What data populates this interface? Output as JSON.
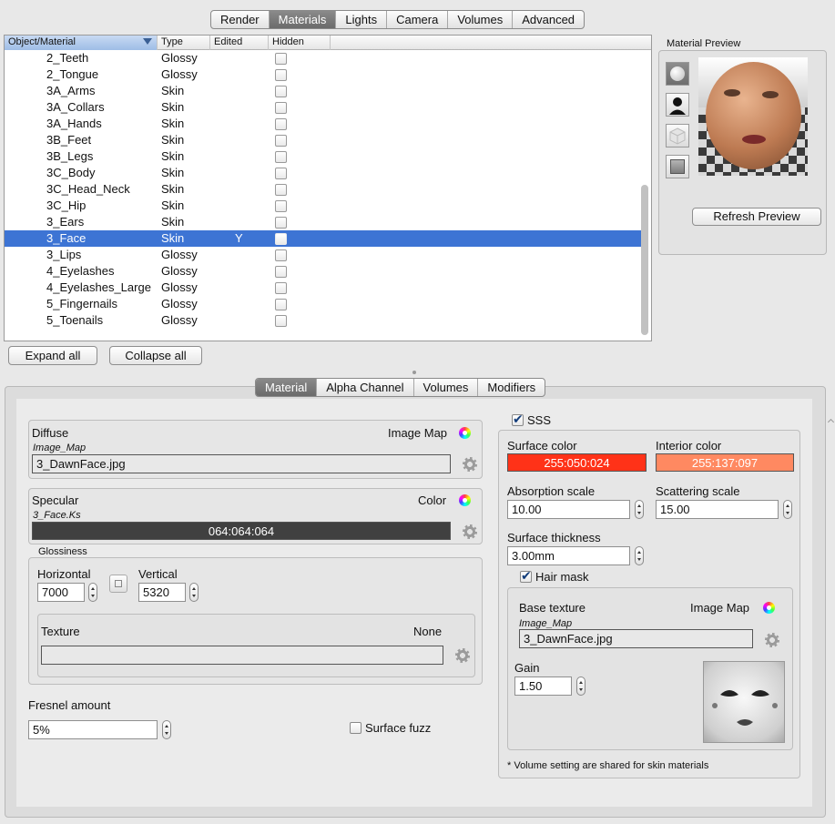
{
  "top_tabs": [
    "Render",
    "Materials",
    "Lights",
    "Camera",
    "Volumes",
    "Advanced"
  ],
  "table": {
    "headers": [
      "Object/Material",
      "Type",
      "Edited",
      "Hidden"
    ],
    "rows": [
      {
        "name": "2_Teeth",
        "type": "Glossy",
        "edited": ""
      },
      {
        "name": "2_Tongue",
        "type": "Glossy",
        "edited": ""
      },
      {
        "name": "3A_Arms",
        "type": "Skin",
        "edited": ""
      },
      {
        "name": "3A_Collars",
        "type": "Skin",
        "edited": ""
      },
      {
        "name": "3A_Hands",
        "type": "Skin",
        "edited": ""
      },
      {
        "name": "3B_Feet",
        "type": "Skin",
        "edited": ""
      },
      {
        "name": "3B_Legs",
        "type": "Skin",
        "edited": ""
      },
      {
        "name": "3C_Body",
        "type": "Skin",
        "edited": ""
      },
      {
        "name": "3C_Head_Neck",
        "type": "Skin",
        "edited": ""
      },
      {
        "name": "3C_Hip",
        "type": "Skin",
        "edited": ""
      },
      {
        "name": "3_Ears",
        "type": "Skin",
        "edited": ""
      },
      {
        "name": "3_Face",
        "type": "Skin",
        "edited": "Y",
        "selected": true
      },
      {
        "name": "3_Lips",
        "type": "Glossy",
        "edited": ""
      },
      {
        "name": "4_Eyelashes",
        "type": "Glossy",
        "edited": ""
      },
      {
        "name": "4_Eyelashes_Large",
        "type": "Glossy",
        "edited": ""
      },
      {
        "name": "5_Fingernails",
        "type": "Glossy",
        "edited": ""
      },
      {
        "name": "5_Toenails",
        "type": "Glossy",
        "edited": ""
      }
    ]
  },
  "expand_all": "Expand all",
  "collapse_all": "Collapse all",
  "preview": {
    "title": "Material Preview",
    "refresh": "Refresh Preview",
    "shape_icons": [
      "sphere-icon",
      "head-icon",
      "cube-icon",
      "plane-icon"
    ]
  },
  "sub_tabs": [
    "Material",
    "Alpha Channel",
    "Volumes",
    "Modifiers"
  ],
  "diffuse": {
    "label": "Diffuse",
    "mode": "Image Map",
    "source": "Image_Map",
    "value": "3_DawnFace.jpg"
  },
  "specular": {
    "label": "Specular",
    "mode": "Color",
    "source": "3_Face.Ks",
    "value": "064:064:064",
    "color": "#404040"
  },
  "glossiness": {
    "label": "Glossiness",
    "horizontal_label": "Horizontal",
    "horizontal": "7000",
    "vertical_label": "Vertical",
    "vertical": "5320",
    "texture_label": "Texture",
    "texture_mode": "None",
    "texture_value": ""
  },
  "fresnel": {
    "label": "Fresnel amount",
    "value": "5%"
  },
  "surface_fuzz": "Surface fuzz",
  "sss": {
    "label": "SSS",
    "surface_color_label": "Surface color",
    "surface_color": "255:050:024",
    "surface_color_hex": "#ff3218",
    "interior_color_label": "Interior color",
    "interior_color": "255:137:097",
    "interior_color_hex": "#ff8961",
    "absorption_label": "Absorption scale",
    "absorption": "10.00",
    "scattering_label": "Scattering scale",
    "scattering": "15.00",
    "thickness_label": "Surface thickness",
    "thickness": "3.00mm",
    "hair_mask": "Hair mask",
    "base_texture_label": "Base texture",
    "base_texture_mode": "Image Map",
    "base_texture_source": "Image_Map",
    "base_texture_value": "3_DawnFace.jpg",
    "gain_label": "Gain",
    "gain": "1.50",
    "note": "* Volume setting are shared for skin materials"
  }
}
